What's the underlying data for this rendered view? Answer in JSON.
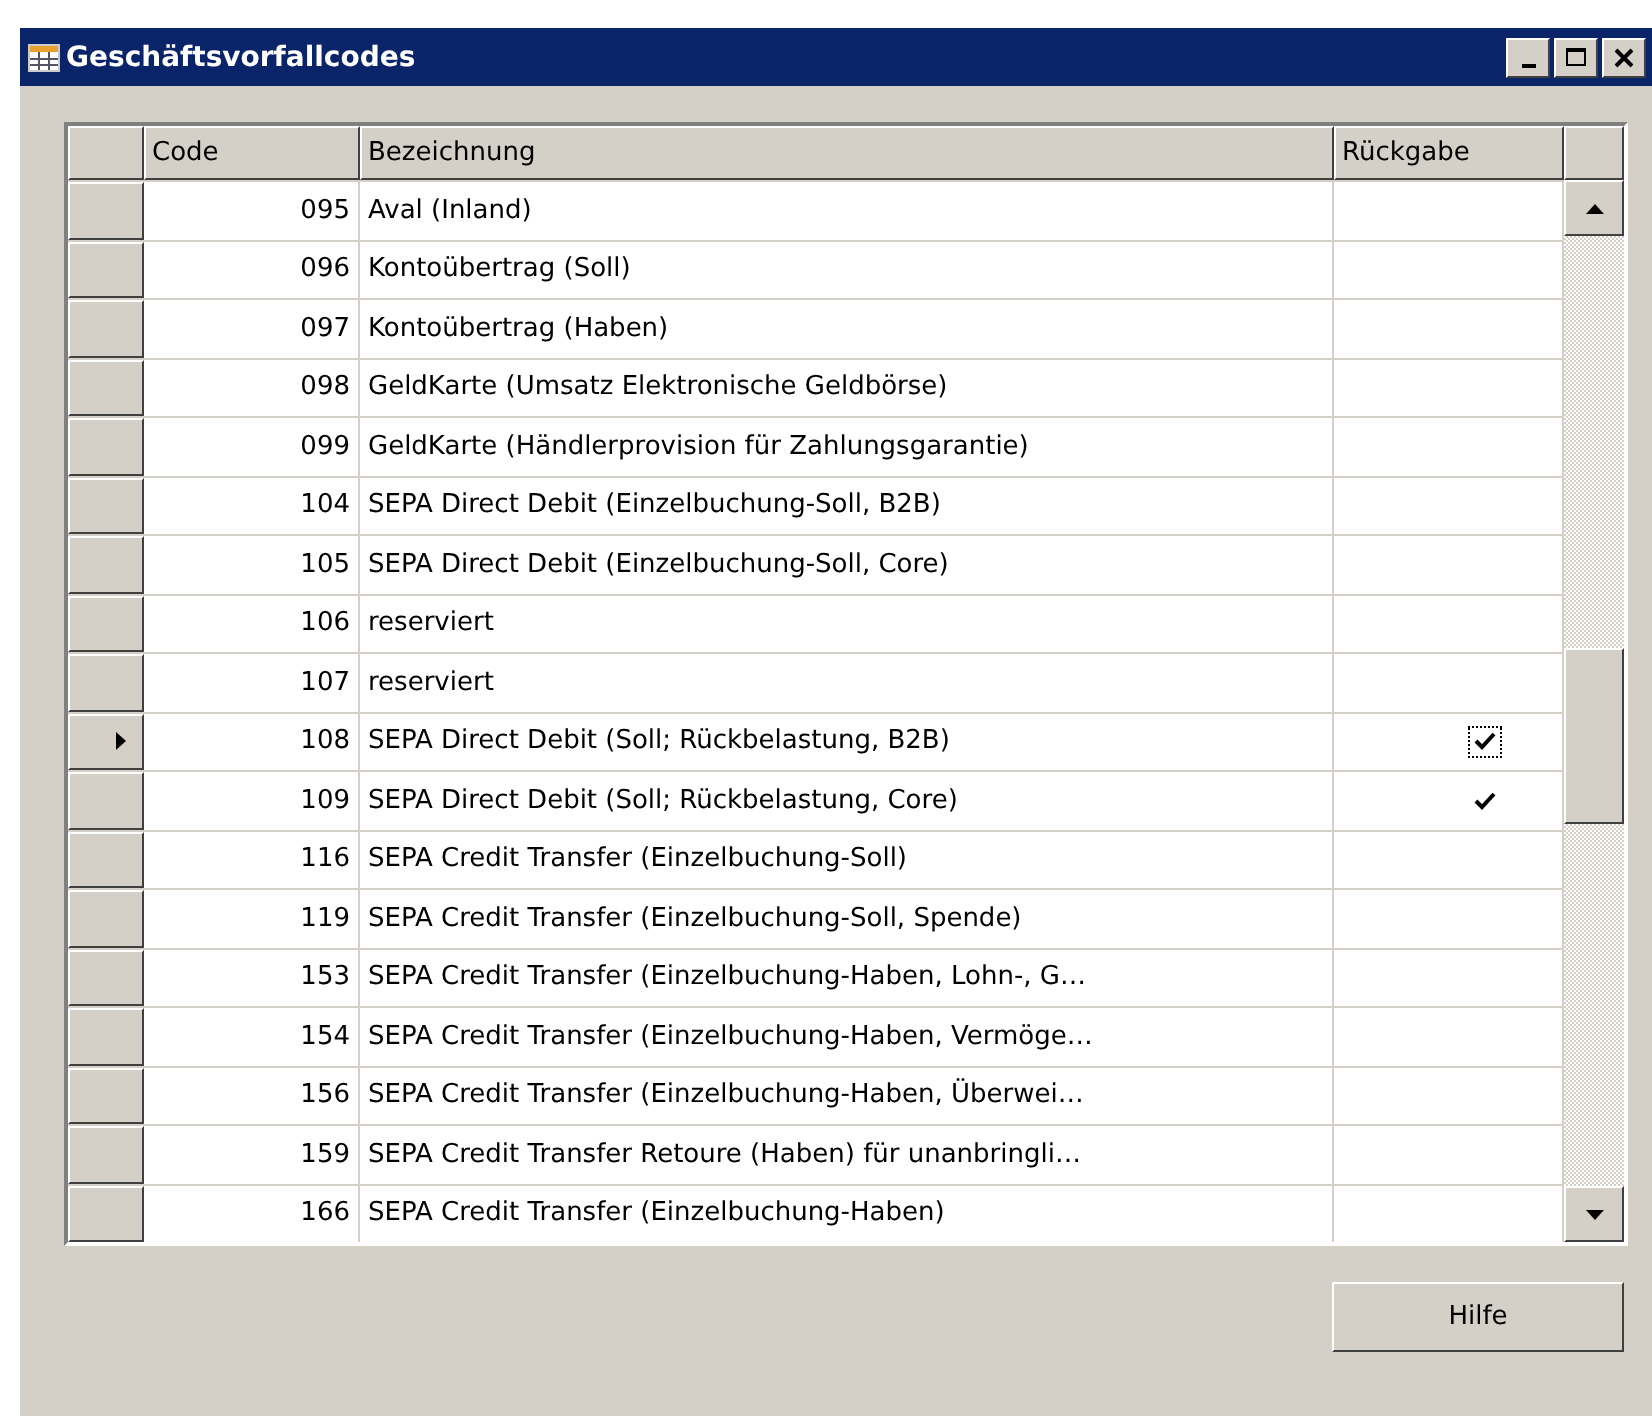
{
  "window": {
    "title": "Geschäftsvorfallcodes"
  },
  "table": {
    "columns": [
      "Code",
      "Bezeichnung",
      "Rückgabe"
    ],
    "rows": [
      {
        "code": "095",
        "bezeichnung": "Aval (Inland)",
        "rueckgabe": false,
        "selected": false
      },
      {
        "code": "096",
        "bezeichnung": "Kontoübertrag (Soll)",
        "rueckgabe": false,
        "selected": false
      },
      {
        "code": "097",
        "bezeichnung": "Kontoübertrag (Haben)",
        "rueckgabe": false,
        "selected": false
      },
      {
        "code": "098",
        "bezeichnung": "GeldKarte (Umsatz Elektronische Geldbörse)",
        "rueckgabe": false,
        "selected": false
      },
      {
        "code": "099",
        "bezeichnung": "GeldKarte (Händlerprovision für Zahlungsgarantie)",
        "rueckgabe": false,
        "selected": false
      },
      {
        "code": "104",
        "bezeichnung": "SEPA Direct Debit (Einzelbuchung-Soll, B2B)",
        "rueckgabe": false,
        "selected": false
      },
      {
        "code": "105",
        "bezeichnung": "SEPA Direct Debit (Einzelbuchung-Soll, Core)",
        "rueckgabe": false,
        "selected": false
      },
      {
        "code": "106",
        "bezeichnung": "reserviert",
        "rueckgabe": false,
        "selected": false
      },
      {
        "code": "107",
        "bezeichnung": "reserviert",
        "rueckgabe": false,
        "selected": false
      },
      {
        "code": "108",
        "bezeichnung": "SEPA Direct Debit (Soll; Rückbelastung, B2B)",
        "rueckgabe": true,
        "selected": true
      },
      {
        "code": "109",
        "bezeichnung": "SEPA Direct Debit (Soll; Rückbelastung, Core)",
        "rueckgabe": true,
        "selected": false
      },
      {
        "code": "116",
        "bezeichnung": "SEPA Credit Transfer (Einzelbuchung-Soll)",
        "rueckgabe": false,
        "selected": false
      },
      {
        "code": "119",
        "bezeichnung": "SEPA Credit Transfer (Einzelbuchung-Soll, Spende)",
        "rueckgabe": false,
        "selected": false
      },
      {
        "code": "153",
        "bezeichnung": "SEPA Credit Transfer (Einzelbuchung-Haben, Lohn-, G…",
        "rueckgabe": false,
        "selected": false
      },
      {
        "code": "154",
        "bezeichnung": "SEPA Credit Transfer (Einzelbuchung-Haben, Vermöge…",
        "rueckgabe": false,
        "selected": false
      },
      {
        "code": "156",
        "bezeichnung": "SEPA Credit Transfer (Einzelbuchung-Haben, Überwei…",
        "rueckgabe": false,
        "selected": false
      },
      {
        "code": "159",
        "bezeichnung": "SEPA Credit Transfer Retoure (Haben)  für unanbringli…",
        "rueckgabe": false,
        "selected": false
      },
      {
        "code": "166",
        "bezeichnung": "SEPA Credit Transfer (Einzelbuchung-Haben)",
        "rueckgabe": false,
        "selected": false
      }
    ]
  },
  "buttons": [
    "Hilfe"
  ]
}
